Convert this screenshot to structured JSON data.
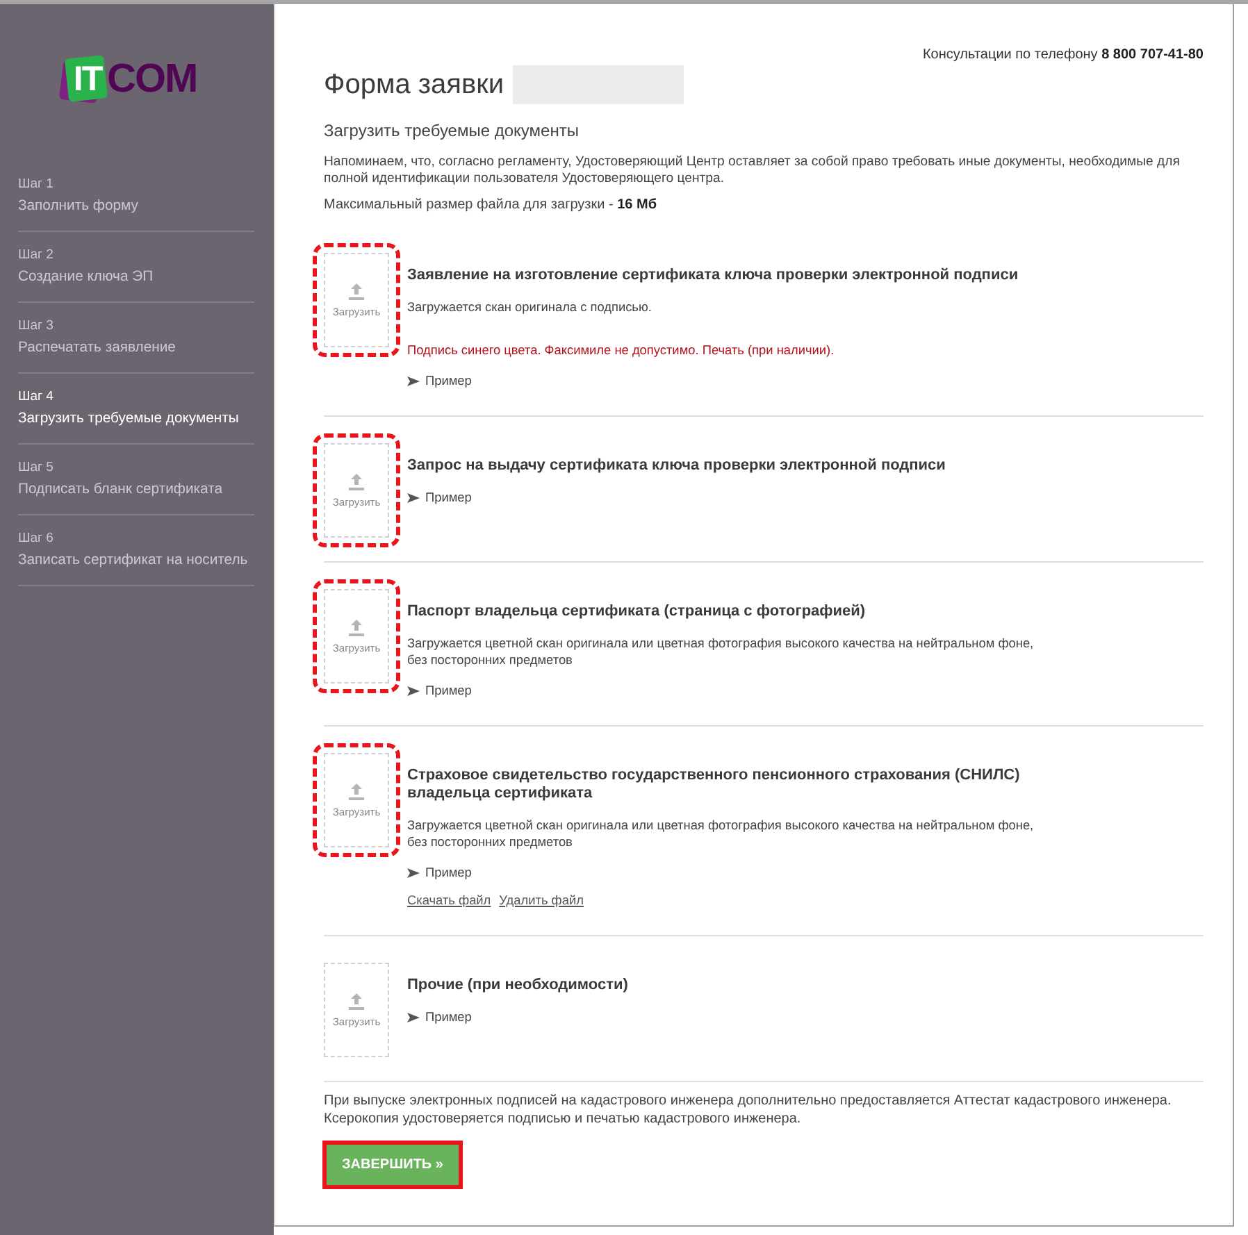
{
  "sidebar": {
    "logo": {
      "badge": "IT",
      "text": "COM"
    },
    "steps": [
      {
        "label": "Шаг 1",
        "title": "Заполнить форму",
        "selected": false
      },
      {
        "label": "Шаг 2",
        "title": "Создание ключа ЭП",
        "selected": false
      },
      {
        "label": "Шаг 3",
        "title": "Распечатать заявление",
        "selected": false
      },
      {
        "label": "Шаг 4",
        "title": "Загрузить требуемые документы",
        "selected": true
      },
      {
        "label": "Шаг 5",
        "title": "Подписать бланк сертификата",
        "selected": false
      },
      {
        "label": "Шаг 6",
        "title": "Записать сертификат на носитель",
        "selected": false
      }
    ]
  },
  "header": {
    "phone": "Консультации по телефону **8 800 707-41-80**"
  },
  "form": {
    "title": "Форма заявки",
    "title_redacted": true,
    "subtitle": "Загрузить требуемые документы",
    "notice": "Напоминаем, что, согласно регламенту, Удостоверяющий Центр оставляет за собой право требовать иные документы, необходимые для\nполной идентификации пользователя Удостоверяющего центра.",
    "max_size": "Максимальный размер файла для загрузки - **16 Мб**"
  },
  "documents": [
    {
      "title": "Заявление на изготовление сертификата ключа проверки электронной подписи",
      "description": "Загружается скан оригинала с подписью.",
      "note": "Подпись синего цвета. Факсимиле не допустимо. Печать (при наличии).",
      "example_link": "Пример",
      "upload_label": "Загрузить",
      "highlighted": true
    },
    {
      "title": "Запрос на выдачу сертификата ключа проверки электронной подписи",
      "example_link": "Пример",
      "upload_label": "Загрузить",
      "highlighted": true
    },
    {
      "title": "Паспорт владельца сертификата (страница с фотографией)",
      "description": "Загружается цветной скан оригинала или цветная фотография высокого качества на нейтральном фоне,\nбез посторонних предметов",
      "example_link": "Пример",
      "upload_label": "Загрузить",
      "highlighted": true
    },
    {
      "title": "Страховое свидетельство государственного пенсионного страхования (СНИЛС)\nвладельца сертификата",
      "description": "Загружается цветной скан оригинала или цветная фотография высокого качества на нейтральном фоне,\nбез посторонних предметов",
      "example_link": "Пример",
      "upload_label": "Загрузить",
      "highlighted": true,
      "file_links": [
        "Скачать файл",
        "Удалить файл"
      ]
    },
    {
      "title": "Прочие (при необходимости)",
      "example_link": "Пример",
      "upload_label": "Загрузить",
      "highlighted": false
    }
  ],
  "footnote": "При выпуске электронных подписей на кадастрового инженера дополнительно предоставляется Аттестат кадастрового инженера.\nКсерокопия удостоверяется подписью и печатью кадастрового инженера.",
  "submit_button": {
    "label": "ЗАВЕРШИТЬ »",
    "highlighted": true
  }
}
